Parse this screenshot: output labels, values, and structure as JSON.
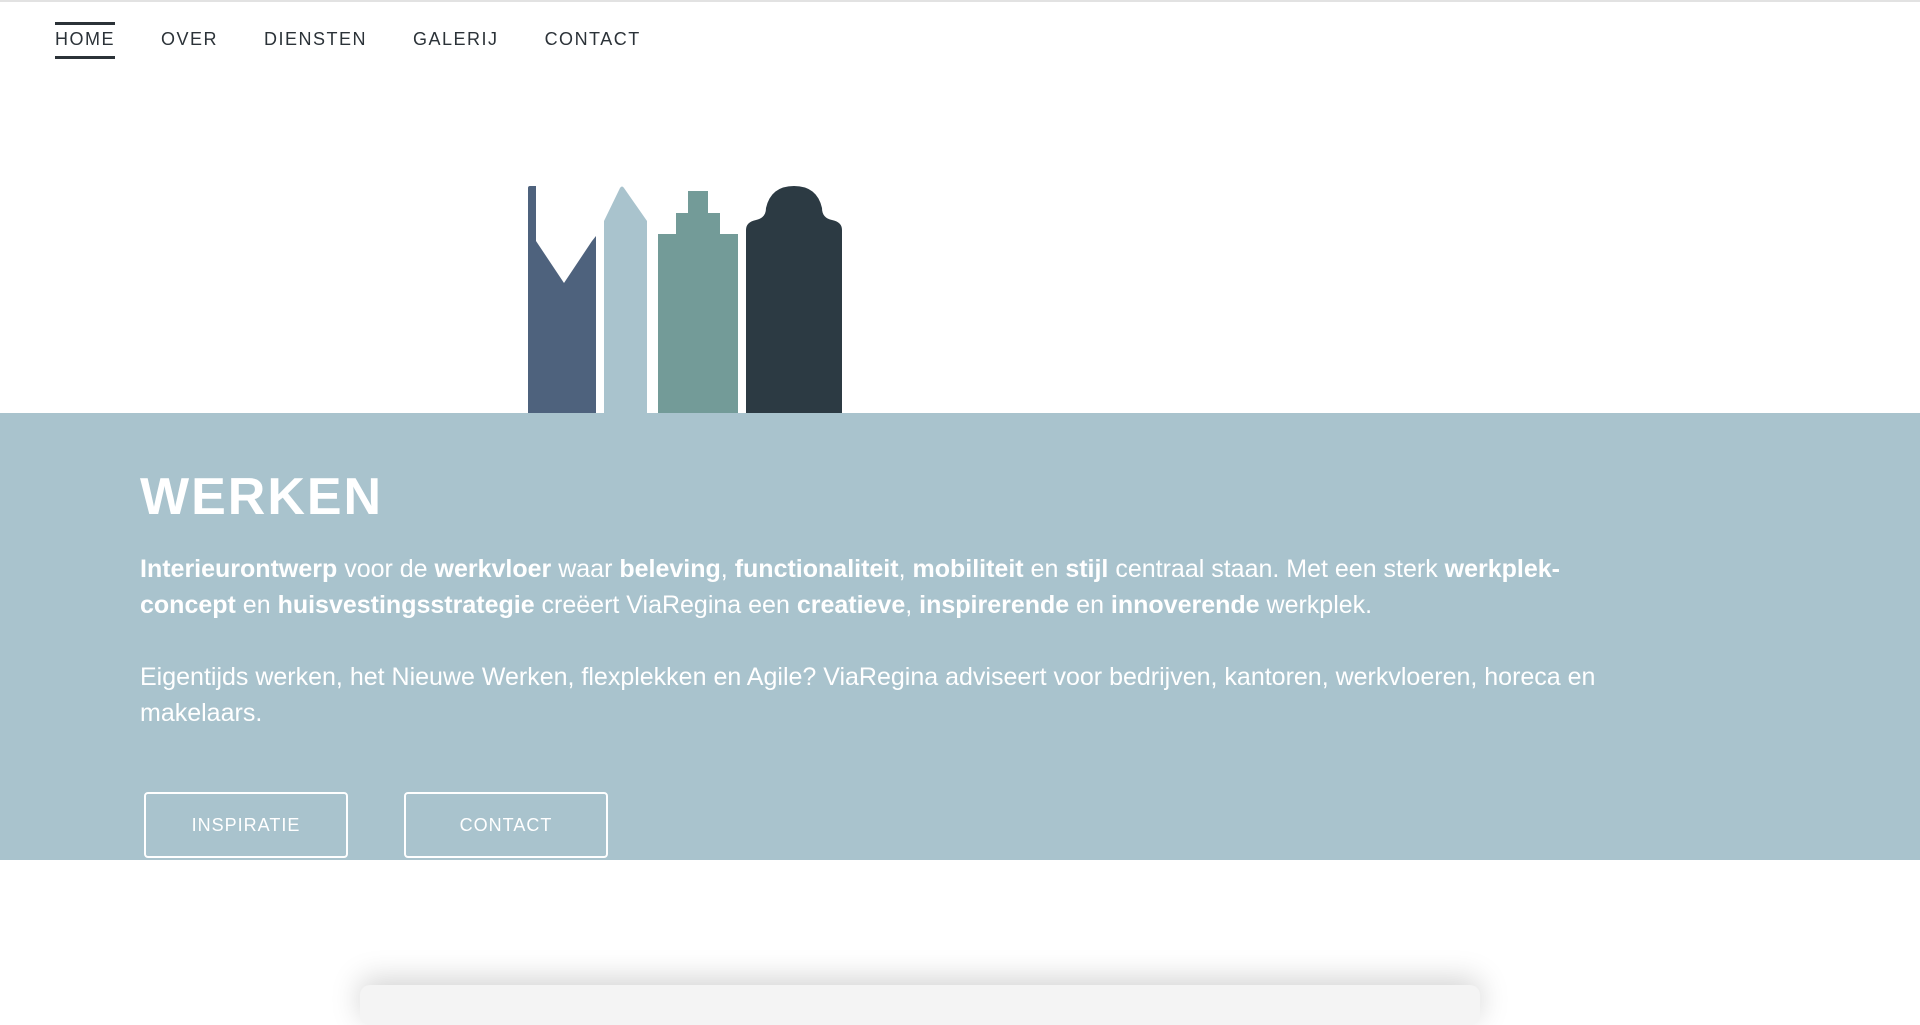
{
  "nav": {
    "items": [
      {
        "label": "HOME",
        "active": true
      },
      {
        "label": "OVER",
        "active": false
      },
      {
        "label": "DIENSTEN",
        "active": false
      },
      {
        "label": "GALERIJ",
        "active": false
      },
      {
        "label": "CONTACT",
        "active": false
      }
    ]
  },
  "logo": {
    "icon": "canal-houses-logo-icon",
    "colors": [
      "#4e627d",
      "#a9c3cd",
      "#739b98",
      "#2c3a43"
    ]
  },
  "hero": {
    "background": "#a9c3cd",
    "title": "WERKEN",
    "paragraph1": [
      {
        "text": "Interieurontwerp",
        "bold": true
      },
      {
        "text": " voor de ",
        "bold": false
      },
      {
        "text": "werkvloer",
        "bold": true
      },
      {
        "text": " waar ",
        "bold": false
      },
      {
        "text": "beleving",
        "bold": true
      },
      {
        "text": ", ",
        "bold": false
      },
      {
        "text": "functionaliteit",
        "bold": true
      },
      {
        "text": ", ",
        "bold": false
      },
      {
        "text": "mobiliteit",
        "bold": true
      },
      {
        "text": " en ",
        "bold": false
      },
      {
        "text": "stijl",
        "bold": true
      },
      {
        "text": " centraal staan. Met een sterk ",
        "bold": false
      },
      {
        "text": "werkplek-concept",
        "bold": true
      },
      {
        "text": " en ",
        "bold": false
      },
      {
        "text": "huisvestingsstrategie",
        "bold": true
      },
      {
        "text": " creëert  ViaRegina een ",
        "bold": false
      },
      {
        "text": "creatieve",
        "bold": true
      },
      {
        "text": ", ",
        "bold": false
      },
      {
        "text": "inspirerende",
        "bold": true
      },
      {
        "text": " en ",
        "bold": false
      },
      {
        "text": "innoverende",
        "bold": true
      },
      {
        "text": " werkplek.",
        "bold": false
      }
    ],
    "paragraph2": "Eigentijds werken, het Nieuwe Werken, flexplekken en Agile? ViaRegina adviseert voor bedrijven, kantoren, werkvloeren, horeca en makelaars.",
    "buttons": {
      "inspiratie": "INSPIRATIE",
      "contact": "CONTACT"
    }
  }
}
